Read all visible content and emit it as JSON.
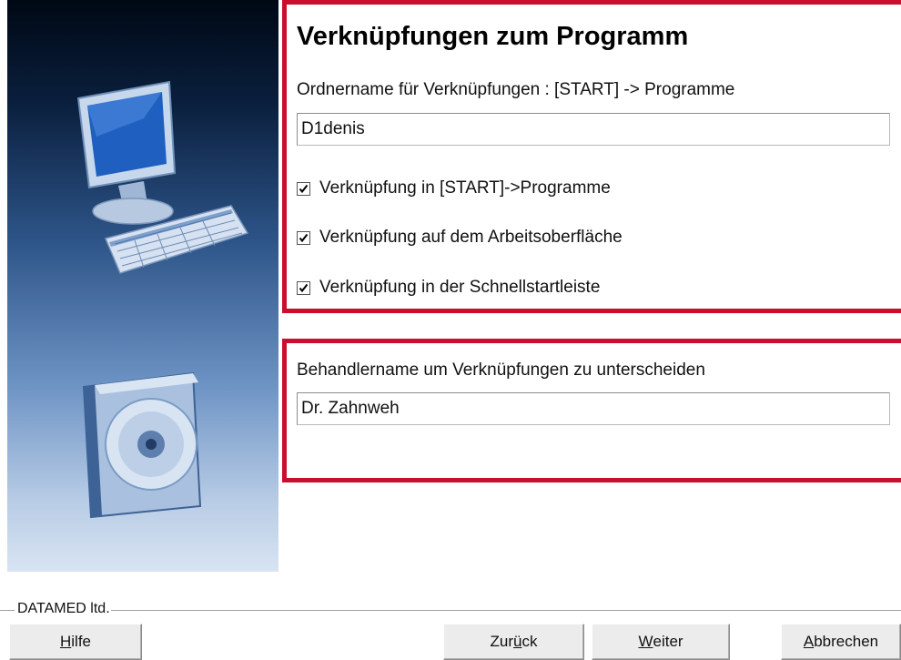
{
  "wizard": {
    "title": "Verknüpfungen zum Programm",
    "folder_label": "Ordnername für Verknüpfungen  :  [START] -> Programme",
    "folder_value": "D1denis",
    "checkboxes": [
      {
        "label": "Verknüpfung in [START]->Programme",
        "checked": true
      },
      {
        "label": "Verknüpfung auf dem Arbeitsoberfläche",
        "checked": true
      },
      {
        "label": "Verknüpfung in der Schnellstartleiste",
        "checked": true
      }
    ],
    "practitioner_label": "Behandlername um Verknüpfungen zu unterscheiden",
    "practitioner_value": "Dr. Zahnweh"
  },
  "footer": {
    "group_label": "DATAMED ltd.",
    "buttons": {
      "help": {
        "accel": "H",
        "rest": "ilfe"
      },
      "back": {
        "pre": "Zur",
        "accel": "ü",
        "rest": "ck"
      },
      "next": {
        "accel": "W",
        "rest": "eiter"
      },
      "cancel": {
        "accel": "A",
        "rest": "bbrechen"
      }
    }
  },
  "colors": {
    "highlight_frame": "#c8102e",
    "side_panel_top": "#000814",
    "side_panel_bottom": "#d8e4f2"
  },
  "icons": [
    "computer-icon",
    "cd-case-icon",
    "checkmark-icon"
  ]
}
